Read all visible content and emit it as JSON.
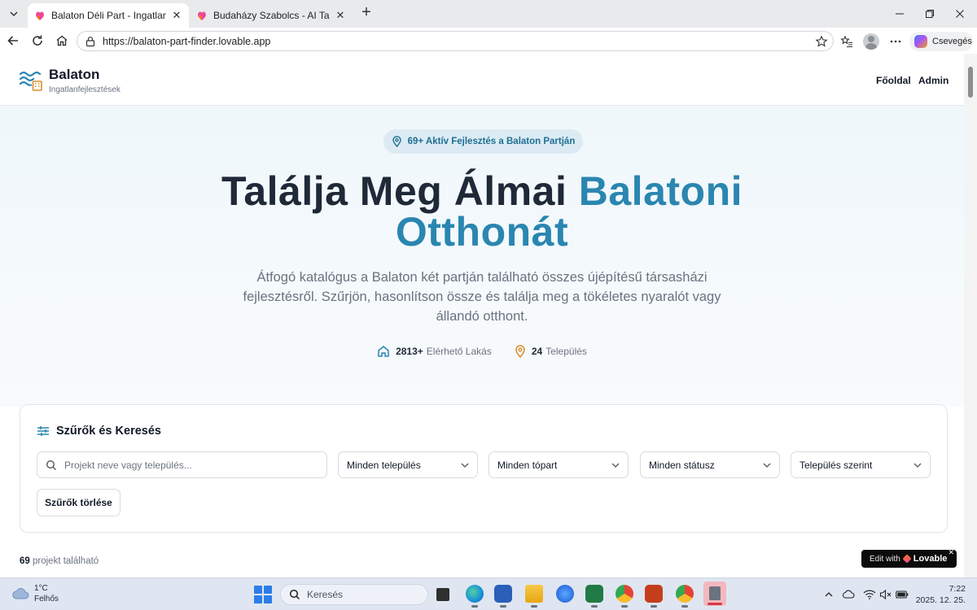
{
  "browser": {
    "tabs": [
      {
        "title": "Balaton Déli Part - Ingatlanfejleszt…",
        "active": true
      },
      {
        "title": "Budaházy Szabolcs - AI Tanácsadó",
        "active": false
      }
    ],
    "url": "https://balaton-part-finder.lovable.app",
    "copilot_label": "Csevegés"
  },
  "site": {
    "brand_name": "Balaton",
    "brand_sub": "Ingatlanfejlesztések",
    "nav": {
      "home": "Főoldal",
      "admin": "Admin"
    }
  },
  "hero": {
    "badge": "69+ Aktív Fejlesztés a Balaton Partján",
    "title_main": "Találja Meg Álmai",
    "title_accent_1": "Balatoni",
    "title_accent_2": "Otthonát",
    "description": "Átfogó katalógus a Balaton két partján található összes újépítésű társasházi fejlesztésről. Szűrjön, hasonlítson össze és találja meg a tökéletes nyaralót vagy állandó otthont.",
    "stats": [
      {
        "value": "2813+",
        "label": "Elérhető Lakás"
      },
      {
        "value": "24",
        "label": "Település"
      }
    ]
  },
  "filters": {
    "title": "Szűrők és Keresés",
    "search_placeholder": "Projekt neve vagy település...",
    "selects": [
      "Minden település",
      "Minden tópart",
      "Minden státusz",
      "Település szerint"
    ],
    "reset_label": "Szűrők törlése"
  },
  "results": {
    "count": "69",
    "label": "projekt található"
  },
  "lovable_badge": {
    "prefix": "Edit with",
    "brand": "Lovable"
  },
  "taskbar": {
    "weather_temp": "1°C",
    "weather_desc": "Felhős",
    "search_label": "Keresés",
    "time": "7:22",
    "date": "2025. 12. 25."
  },
  "colors": {
    "accent": "#2a86b0",
    "badge_bg": "#dcebf3",
    "stat_orange": "#d98b2b"
  }
}
